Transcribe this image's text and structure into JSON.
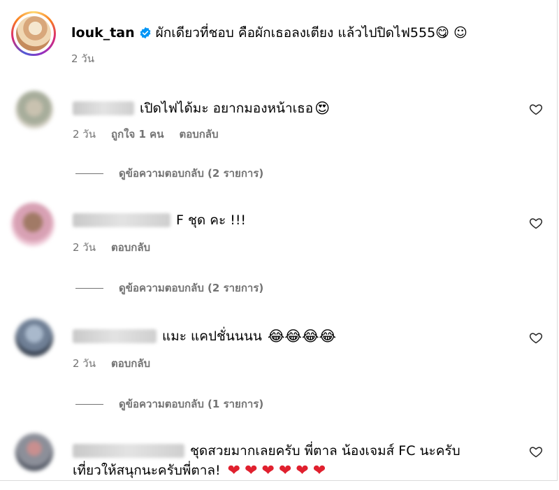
{
  "caption": {
    "username": "louk_tan",
    "text": "ผักเดียวที่ชอบ คือผักเธอลงเตียง แล้วไปปิดไฟ555😋 ☺",
    "time": "2 วัน"
  },
  "comments": [
    {
      "text": "เปิดไฟได้มะ อยากมองหน้าเธอ",
      "emoji": "😍",
      "time": "2 วัน",
      "likes": "ถูกใจ 1 คน",
      "reply_label": "ตอบกลับ",
      "view_replies": "ดูข้อความตอบกลับ (2 รายการ)"
    },
    {
      "text": "F ชุด คะ !!!",
      "time": "2 วัน",
      "reply_label": "ตอบกลับ",
      "view_replies": "ดูข้อความตอบกลับ (2 รายการ)"
    },
    {
      "text": "แมะ แคปชั่นนนน",
      "emoji": "😂😂😂😂",
      "time": "2 วัน",
      "reply_label": "ตอบกลับ",
      "view_replies": "ดูข้อความตอบกลับ (1 รายการ)"
    },
    {
      "text": "ชุดสวยมากเลยครับ พี่ตาล น้องเจมส์ FC นะครับ",
      "text2": "เที่ยวให้สนุกนะครับพี่ตาล!",
      "emoji": "❤❤❤❤❤❤"
    }
  ],
  "colors": {
    "verified": "#0095f6",
    "muted": "#737373",
    "heart_red": "#e0202e"
  },
  "icons": {
    "like": "heart-outline-icon",
    "verified": "verified-badge-icon"
  }
}
